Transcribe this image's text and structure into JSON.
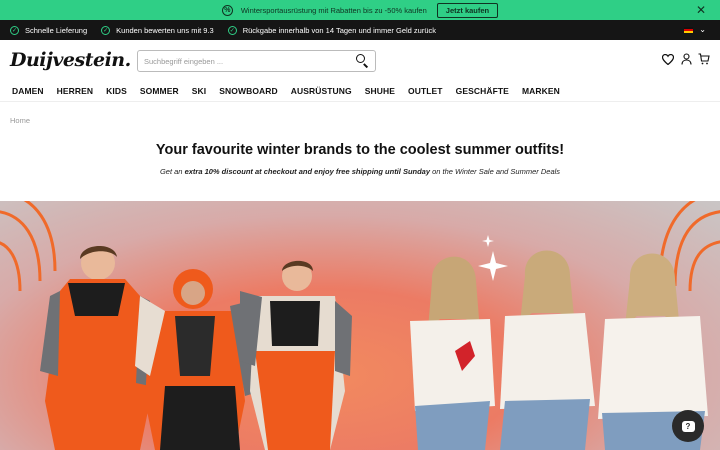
{
  "promo": {
    "text": "Wintersportausrüstung mit Rabatten bis zu -50% kaufen",
    "button": "Jetzt kaufen",
    "icon": "percent-badge-icon",
    "bg_color": "#2fcf86"
  },
  "usp": {
    "items": [
      "Schnelle Lieferung",
      "Kunden bewerten uns mit 9.3",
      "Rückgabe innerhalb von 14 Tagen und immer Geld zurück"
    ],
    "language_flag": "german-flag-icon"
  },
  "header": {
    "logo": "Duijvestein.",
    "search_placeholder": "Suchbegriff eingeben ..."
  },
  "nav": {
    "items": [
      "DAMEN",
      "HERREN",
      "KIDS",
      "SOMMER",
      "SKI",
      "SNOWBOARD",
      "AUSRÜSTUNG",
      "SHUHE",
      "OUTLET",
      "GESCHÄFTE",
      "MARKEN"
    ]
  },
  "breadcrumb": "Home",
  "hero": {
    "headline": "Your favourite winter brands to the coolest summer outfits!",
    "sub_prefix": "Get an ",
    "sub_bold": "extra 10% discount at checkout and enjoy free shipping until Sunday",
    "sub_suffix": " on the Winter Sale and Summer Deals"
  },
  "chat": {
    "label": "?"
  }
}
